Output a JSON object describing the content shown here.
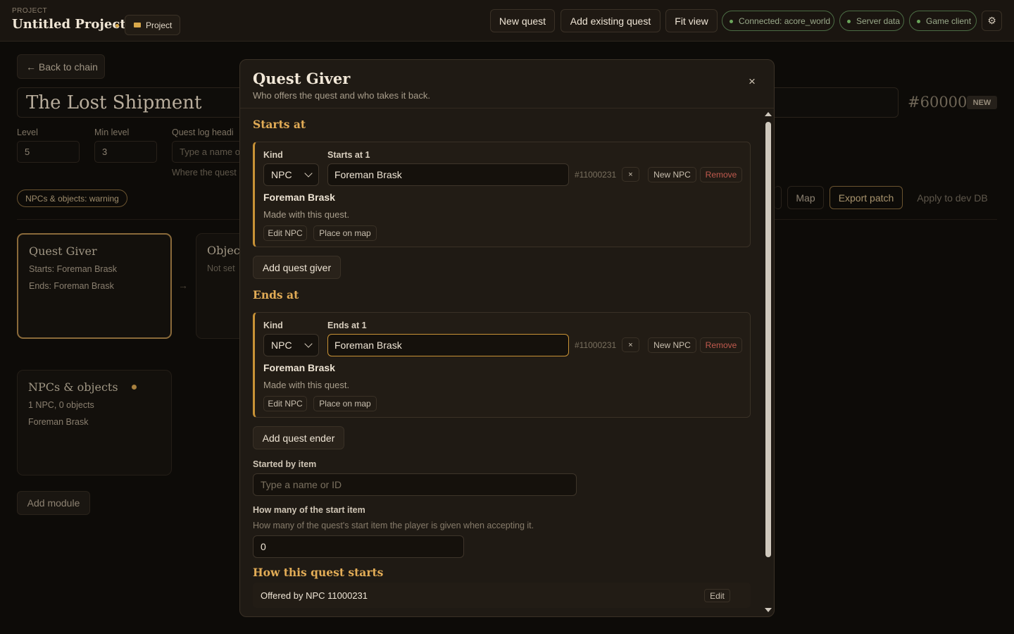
{
  "topbar": {
    "project_label": "PROJECT",
    "project_title": "Untitled Project",
    "project_chip": "Project",
    "buttons": {
      "new_quest": "New quest",
      "add_existing": "Add existing quest",
      "fit_view": "Fit view"
    },
    "status": {
      "connected": "Connected: acore_world",
      "server_data": "Server data",
      "game_client": "Game client"
    },
    "settings_icon": "gear-icon"
  },
  "page": {
    "back": "← Back to chain",
    "quest_title": "The Lost Shipment",
    "quest_id": "#60000",
    "new_badge": "NEW",
    "level_label": "Level",
    "level_value": "5",
    "min_level_label": "Min level",
    "min_level_value": "3",
    "quest_log_label": "Quest log headi",
    "quest_log_placeholder": "Type a name o",
    "where_hint": "Where the quest",
    "warning_chip": "NPCs & objects: warning",
    "map_btn": "Map",
    "export_btn": "Export patch",
    "apply_btn": "Apply to dev DB",
    "cards": {
      "giver": {
        "title": "Quest Giver",
        "starts": "Starts: Foreman Brask",
        "ends": "Ends: Foreman Brask"
      },
      "objective": {
        "title": "Object",
        "not_set": "Not set"
      },
      "npcs": {
        "title": "NPCs & objects",
        "count": "1 NPC, 0 objects",
        "item": "Foreman Brask"
      }
    },
    "arrow": "→",
    "add_module": "Add module"
  },
  "modal": {
    "title": "Quest Giver",
    "subtitle": "Who offers the quest and who takes it back.",
    "close": "×",
    "starts_heading": "Starts at",
    "starts": {
      "kind_label": "Kind",
      "field_label": "Starts at 1",
      "kind": "NPC",
      "value": "Foreman Brask",
      "id": "#11000231",
      "x": "×",
      "new_npc": "New NPC",
      "remove": "Remove",
      "name": "Foreman Brask",
      "note": "Made with this quest.",
      "edit_npc": "Edit NPC",
      "place_on_map": "Place on map"
    },
    "add_giver": "Add quest giver",
    "ends_heading": "Ends at",
    "ends": {
      "kind_label": "Kind",
      "field_label": "Ends at 1",
      "kind": "NPC",
      "value": "Foreman Brask",
      "id": "#11000231",
      "x": "×",
      "new_npc": "New NPC",
      "remove": "Remove",
      "name": "Foreman Brask",
      "note": "Made with this quest.",
      "edit_npc": "Edit NPC",
      "place_on_map": "Place on map"
    },
    "add_ender": "Add quest ender",
    "started_by_item_label": "Started by item",
    "started_by_item_placeholder": "Type a name or ID",
    "start_item_count_label": "How many of the start item",
    "start_item_count_help": "How many of the quest's start item the player is given when accepting it.",
    "start_item_count_value": "0",
    "how_starts_heading": "How this quest starts",
    "offered_by": "Offered by NPC 11000231",
    "edit": "Edit"
  }
}
